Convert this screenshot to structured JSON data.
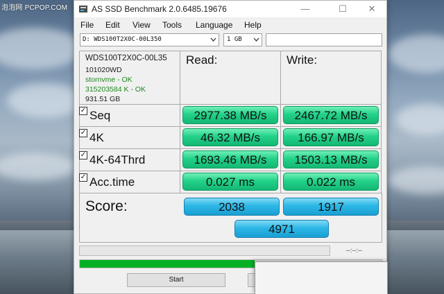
{
  "watermark": "泡泡网 PCPOP.COM",
  "window": {
    "title": "AS SSD Benchmark 2.0.6485.19676"
  },
  "menu": [
    "File",
    "Edit",
    "View",
    "Tools",
    "Language",
    "Help"
  ],
  "toolbar": {
    "drive": "D: WDS100T2X0C-00L350",
    "size": "1 GB",
    "extra_value": ""
  },
  "drive_info": {
    "model": "WDS100T2X0C-00L35",
    "firmware": "101020WD",
    "driver": "stornvme - OK",
    "alignment": "315203584 K - OK",
    "capacity": "931.51 GB"
  },
  "columns": {
    "read": "Read:",
    "write": "Write:"
  },
  "tests": [
    {
      "label": "Seq",
      "checked": true,
      "read": "2977.38 MB/s",
      "write": "2467.72 MB/s"
    },
    {
      "label": "4K",
      "checked": true,
      "read": "46.32 MB/s",
      "write": "166.97 MB/s"
    },
    {
      "label": "4K-64Thrd",
      "checked": true,
      "read": "1693.46 MB/s",
      "write": "1503.13 MB/s"
    },
    {
      "label": "Acc.time",
      "checked": true,
      "read": "0.027 ms",
      "write": "0.022 ms"
    }
  ],
  "score": {
    "label": "Score:",
    "read": "2038",
    "write": "1917",
    "total": "4971"
  },
  "progress": {
    "time": "--:--:--",
    "overall_fraction": 0.58
  },
  "buttons": {
    "start": "Start"
  },
  "colors": {
    "result_green": "#23d189",
    "score_blue": "#2cb7e6",
    "progress_green": "#06b025"
  },
  "icons": [
    "ssd-app-icon",
    "minimize-icon",
    "maximize-icon",
    "close-icon",
    "dropdown-arrow-icon",
    "checkmark-icon"
  ]
}
